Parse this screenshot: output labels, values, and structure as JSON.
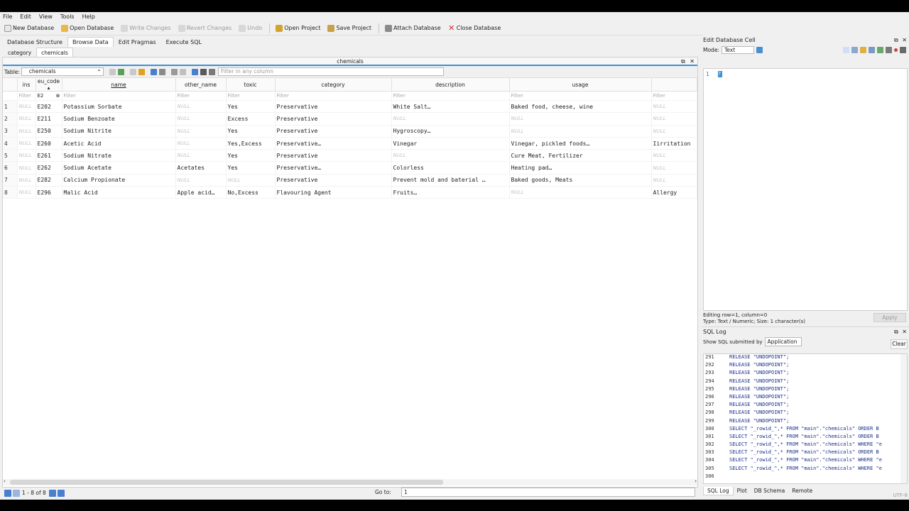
{
  "menu": [
    "File",
    "Edit",
    "View",
    "Tools",
    "Help"
  ],
  "toolbar": {
    "new_database": "New Database",
    "open_database": "Open Database",
    "write_changes": "Write Changes",
    "revert_changes": "Revert Changes",
    "undo": "Undo",
    "open_project": "Open Project",
    "save_project": "Save Project",
    "attach_database": "Attach Database",
    "close_database": "Close Database"
  },
  "main_tabs": [
    "Database Structure",
    "Browse Data",
    "Edit Pragmas",
    "Execute SQL"
  ],
  "sub_tabs": [
    "category",
    "chemicals"
  ],
  "pane_title": "chemicals",
  "table_label": "Table:",
  "table_name": "chemicals",
  "filter_any_placeholder": "Filter in any column",
  "columns": [
    "ins",
    "eu_code ▴",
    "name",
    "other_name",
    "toxic",
    "category",
    "description",
    "usage",
    ""
  ],
  "filter_placeholder": "Filter",
  "eu_code_filter": "E2",
  "null_label": "NULL",
  "rows": [
    {
      "num": "1",
      "cells": [
        null,
        "E202",
        "Potassium Sorbate",
        null,
        "Yes",
        "Preservative",
        "White Salt…",
        "Baked food, cheese, wine",
        null
      ]
    },
    {
      "num": "2",
      "cells": [
        null,
        "E211",
        "Sodium Benzoate",
        null,
        "Excess",
        "Preservative",
        null,
        null,
        null
      ]
    },
    {
      "num": "3",
      "cells": [
        null,
        "E250",
        "Sodium Nitrite",
        null,
        "Yes",
        "Preservative",
        "Hygroscopy…",
        null,
        null
      ]
    },
    {
      "num": "4",
      "cells": [
        null,
        "E260",
        "Acetic Acid",
        null,
        "Yes,Excess",
        "Preservative…",
        "Vinegar",
        "Vinegar, pickled foods…",
        "Iirritation"
      ]
    },
    {
      "num": "5",
      "cells": [
        null,
        "E261",
        "Sodium Nitrate",
        null,
        "Yes",
        "Preservative",
        null,
        "Cure Meat, Fertilizer",
        null
      ]
    },
    {
      "num": "6",
      "cells": [
        null,
        "E262",
        "Sodium Acetate",
        "Acetates",
        "Yes",
        "Preservative…",
        "Colorless",
        "Heating pad…",
        null
      ]
    },
    {
      "num": "7",
      "cells": [
        null,
        "E282",
        "Calcium Propionate",
        null,
        null,
        "Preservative",
        "Prevent mold and baterial …",
        "Baked goods, Meats",
        null
      ]
    },
    {
      "num": "8",
      "cells": [
        null,
        "E296",
        "Malic Acid",
        "Apple acid…",
        "No,Excess",
        "Flavouring Agent",
        "Fruits…",
        null,
        "Allergy"
      ]
    }
  ],
  "record_count": "1 - 8 of 8",
  "goto_label": "Go to:",
  "goto_value": "1",
  "edit_cell": {
    "title": "Edit Database Cell",
    "mode_label": "Mode:",
    "mode_value": "Text",
    "line_number": "1",
    "cell_value": "?",
    "info_line1": "Editing row=1, column=0",
    "info_line2": "Type: Text / Numeric; Size: 1 character(s)",
    "apply": "Apply"
  },
  "sql_log": {
    "title": "SQL Log",
    "show_label": "Show SQL submitted by",
    "show_value": "Application",
    "clear": "Clear",
    "lines": [
      {
        "n": "291",
        "q": "RELEASE \"UNDOPOINT\";"
      },
      {
        "n": "292",
        "q": "RELEASE \"UNDOPOINT\";"
      },
      {
        "n": "293",
        "q": "RELEASE \"UNDOPOINT\";"
      },
      {
        "n": "294",
        "q": "RELEASE \"UNDOPOINT\";"
      },
      {
        "n": "295",
        "q": "RELEASE \"UNDOPOINT\";"
      },
      {
        "n": "296",
        "q": "RELEASE \"UNDOPOINT\";"
      },
      {
        "n": "297",
        "q": "RELEASE \"UNDOPOINT\";"
      },
      {
        "n": "298",
        "q": "RELEASE \"UNDOPOINT\";"
      },
      {
        "n": "299",
        "q": "RELEASE \"UNDOPOINT\";"
      },
      {
        "n": "300",
        "q": "SELECT \"_rowid_\",* FROM \"main\".\"chemicals\"  ORDER B"
      },
      {
        "n": "301",
        "q": "SELECT \"_rowid_\",* FROM \"main\".\"chemicals\"  ORDER B"
      },
      {
        "n": "302",
        "q": "SELECT \"_rowid_\",* FROM \"main\".\"chemicals\" WHERE \"e"
      },
      {
        "n": "303",
        "q": "SELECT \"_rowid_\",* FROM \"main\".\"chemicals\"  ORDER B"
      },
      {
        "n": "304",
        "q": "SELECT \"_rowid_\",* FROM \"main\".\"chemicals\" WHERE \"e"
      },
      {
        "n": "305",
        "q": "SELECT \"_rowid_\",* FROM \"main\".\"chemicals\" WHERE \"e"
      },
      {
        "n": "306",
        "q": ""
      }
    ],
    "bottom_tabs": [
      "SQL Log",
      "Plot",
      "DB Schema",
      "Remote"
    ]
  },
  "encoding": "UTF-8",
  "colors": {
    "accent": "#3d8fd6",
    "sql_text": "#1a2f8a",
    "close_red": "#d03030"
  }
}
